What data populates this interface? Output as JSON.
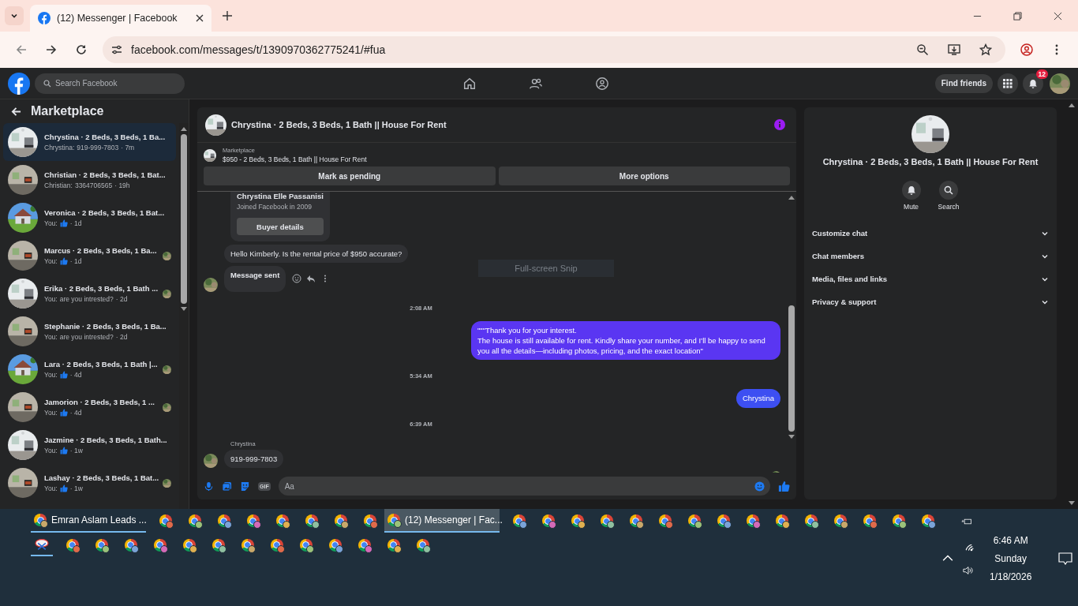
{
  "browser": {
    "tab_title": "(12) Messenger | Facebook",
    "url": "facebook.com/messages/t/1390970362775241/#fua"
  },
  "topnav": {
    "search_placeholder": "Search Facebook",
    "find_friends": "Find friends",
    "notification_count": "12"
  },
  "sidebar": {
    "title": "Marketplace",
    "items": [
      {
        "title": "Chrystina · 2 Beds, 3 Beds, 1 Ba...",
        "sender": "Chrystina:",
        "message": "919-999-7803",
        "like": false,
        "time": "· 7m",
        "selected": true,
        "seen": false
      },
      {
        "title": "Christian · 2 Beds, 3 Beds, 1 Bat...",
        "sender": "Christian:",
        "message": "3364706565",
        "like": false,
        "time": "· 19h",
        "selected": false,
        "seen": false
      },
      {
        "title": "Veronica · 2 Beds, 3 Beds, 1 Bat...",
        "sender": "You:",
        "like": true,
        "time": "· 1d",
        "selected": false,
        "seen": false
      },
      {
        "title": "Marcus · 2 Beds, 3 Beds, 1 Ba...",
        "sender": "You:",
        "like": true,
        "time": "· 1d",
        "selected": false,
        "seen": true
      },
      {
        "title": "Erika · 2 Beds, 3 Beds, 1 Bath ...",
        "sender": "You:",
        "message": "are you intrested?",
        "like": false,
        "time": "· 2d",
        "selected": false,
        "seen": true
      },
      {
        "title": "Stephanie · 2 Beds, 3 Beds, 1 Ba...",
        "sender": "You:",
        "message": "are you intrested?",
        "like": false,
        "time": "· 2d",
        "selected": false,
        "seen": false
      },
      {
        "title": "Lara · 2 Beds, 3 Beds, 1 Bath |...",
        "sender": "You:",
        "like": true,
        "time": "· 4d",
        "selected": false,
        "seen": true
      },
      {
        "title": "Jamorion · 2 Beds, 3 Beds, 1 ...",
        "sender": "You:",
        "like": true,
        "time": "· 4d",
        "selected": false,
        "seen": true
      },
      {
        "title": "Jazmine · 2 Beds, 3 Beds, 1 Bath...",
        "sender": "You:",
        "like": true,
        "time": "· 1w",
        "selected": false,
        "seen": false
      },
      {
        "title": "Lashay · 2 Beds, 3 Beds, 1 Bat...",
        "sender": "You:",
        "like": true,
        "time": "· 1w",
        "selected": false,
        "seen": true
      }
    ]
  },
  "chat": {
    "title": "Chrystina · 2 Beds, 3 Beds, 1 Bath || House For Rent",
    "listing_label": "Marketplace",
    "listing": "$950 - 2 Beds, 3 Beds, 1 Bath || House For Rent",
    "actions": [
      "Mark as pending",
      "More options"
    ],
    "messages": [
      {
        "kind": "buyer_card",
        "name": "Chrystina Elle Passanisi",
        "subtitle": "Joined Facebook in 2009",
        "button": "Buyer details"
      },
      {
        "kind": "incoming",
        "text": "Hello Kimberly. Is the rental price of $950 accurate?",
        "avatar": false
      },
      {
        "kind": "note",
        "text": "Message sent",
        "avatar": true
      },
      {
        "kind": "timestamp",
        "text": "2:08 AM"
      },
      {
        "kind": "outgoing",
        "text": "\"\"\"Thank you for your interest.\nThe house is still available for rent. Kindly share your number, and I’ll be happy to send you all the details—including photos, pricing, and the exact location\"",
        "color": "#5a36f2"
      },
      {
        "kind": "timestamp",
        "text": "5:34 AM"
      },
      {
        "kind": "outgoing",
        "text": "Chrystina",
        "color": "#3d4ff2"
      },
      {
        "kind": "timestamp",
        "text": "6:39 AM"
      },
      {
        "kind": "incoming",
        "sender": "Chrystina",
        "text": "919-999-7803",
        "avatar": true
      }
    ],
    "snip_tooltip": "Full-screen Snip",
    "composer": {
      "placeholder": "Aa",
      "gif_label": "GIF"
    }
  },
  "details": {
    "title": "Chrystina · 2 Beds, 3 Beds, 1 Bath || House For Rent",
    "buttons": [
      "Mute",
      "Search"
    ],
    "sections": [
      "Customize chat",
      "Chat members",
      "Media, files and links",
      "Privacy & support"
    ]
  },
  "taskbar": {
    "row_1": [
      {
        "kind": "window",
        "label": "Emran Aslam Leads ...",
        "selected": false
      },
      {
        "kind": "chrome"
      },
      {
        "kind": "chrome"
      },
      {
        "kind": "chrome"
      },
      {
        "kind": "chrome"
      },
      {
        "kind": "chrome"
      },
      {
        "kind": "chrome"
      },
      {
        "kind": "chrome"
      },
      {
        "kind": "chrome"
      },
      {
        "kind": "window",
        "label": "(12) Messenger | Fac...",
        "selected": true
      },
      {
        "kind": "chrome"
      },
      {
        "kind": "chrome"
      },
      {
        "kind": "chrome"
      },
      {
        "kind": "chrome"
      },
      {
        "kind": "chrome"
      },
      {
        "kind": "chrome"
      },
      {
        "kind": "chrome"
      },
      {
        "kind": "chrome"
      },
      {
        "kind": "chrome"
      },
      {
        "kind": "chrome"
      },
      {
        "kind": "chrome"
      },
      {
        "kind": "chrome"
      },
      {
        "kind": "chrome"
      },
      {
        "kind": "chrome"
      },
      {
        "kind": "chrome"
      }
    ],
    "row_2": [
      {
        "kind": "snip"
      },
      {
        "kind": "chrome"
      },
      {
        "kind": "chrome"
      },
      {
        "kind": "chrome"
      },
      {
        "kind": "chrome"
      },
      {
        "kind": "chrome"
      },
      {
        "kind": "chrome"
      },
      {
        "kind": "chrome"
      },
      {
        "kind": "chrome"
      },
      {
        "kind": "chrome"
      },
      {
        "kind": "chrome"
      },
      {
        "kind": "chrome"
      },
      {
        "kind": "chrome"
      },
      {
        "kind": "chrome"
      }
    ],
    "time": "6:46 AM",
    "day": "Sunday",
    "date": "1/18/2026"
  }
}
